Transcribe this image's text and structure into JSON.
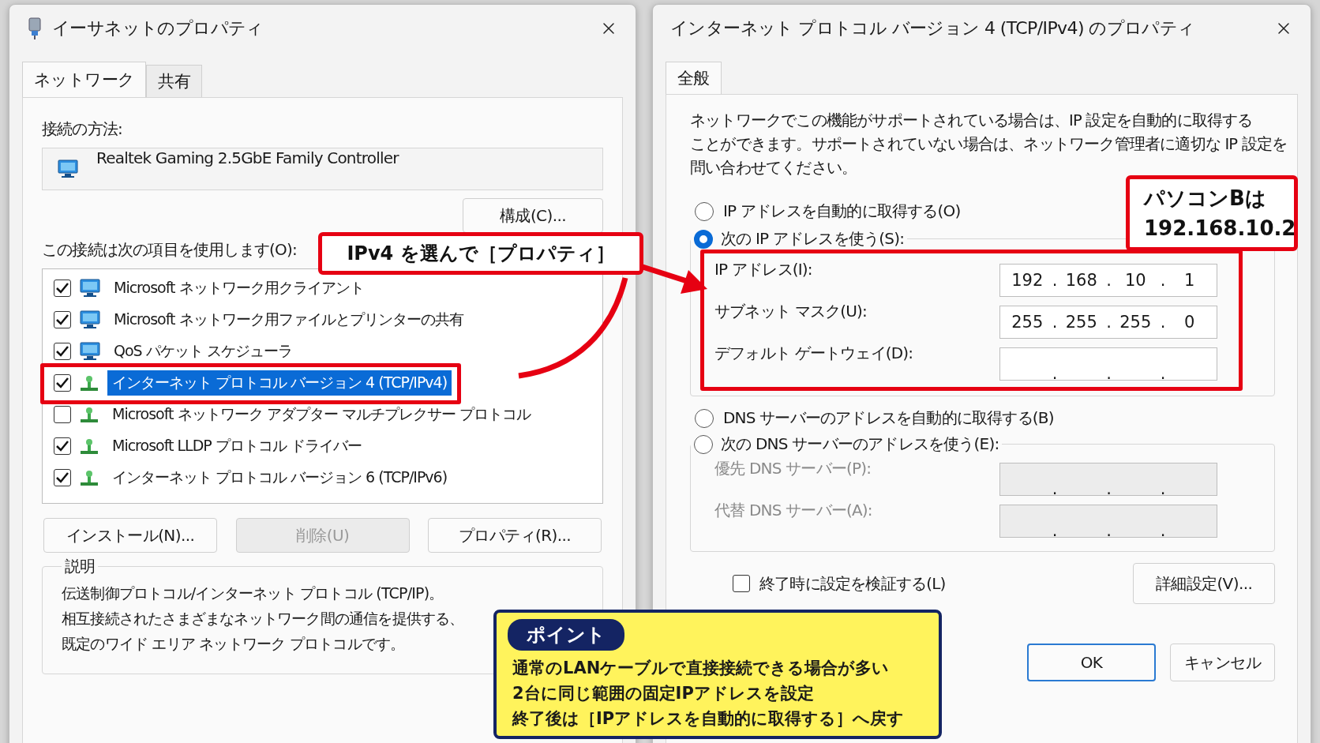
{
  "left_window": {
    "title": "イーサネットのプロパティ",
    "tabs": [
      {
        "label": "ネットワーク",
        "selected": true
      },
      {
        "label": "共有",
        "selected": false
      }
    ],
    "connect_using_label": "接続の方法:",
    "adapter": "Realtek Gaming 2.5GbE Family Controller",
    "configure_button": "構成(C)...",
    "items_label": "この接続は次の項目を使用します(O):",
    "items": [
      {
        "kind": "service",
        "label": "Microsoft ネットワーク用クライアント",
        "checked": true,
        "selected": false
      },
      {
        "kind": "service",
        "label": "Microsoft ネットワーク用ファイルとプリンターの共有",
        "checked": true,
        "selected": false
      },
      {
        "kind": "service",
        "label": "QoS パケット スケジューラ",
        "checked": true,
        "selected": false
      },
      {
        "kind": "protocol",
        "label": "インターネット プロトコル バージョン 4 (TCP/IPv4)",
        "checked": true,
        "selected": true
      },
      {
        "kind": "protocol",
        "label": "Microsoft ネットワーク アダプター マルチプレクサー プロトコル",
        "checked": false,
        "selected": false
      },
      {
        "kind": "protocol",
        "label": "Microsoft LLDP プロトコル ドライバー",
        "checked": true,
        "selected": false
      },
      {
        "kind": "protocol",
        "label": "インターネット プロトコル バージョン 6 (TCP/IPv6)",
        "checked": true,
        "selected": false
      }
    ],
    "buttons": [
      {
        "label": "インストール(N)...",
        "disabled": false
      },
      {
        "label": "削除(U)",
        "disabled": true
      },
      {
        "label": "プロパティ(R)...",
        "disabled": false
      }
    ],
    "description_label": "説明",
    "description_lines": [
      "伝送制御プロトコル/インターネット プロトコル (TCP/IP)。",
      "相互接続されたさまざまなネットワーク間の通信を提供する、",
      "既定のワイド エリア ネットワーク プロトコルです。"
    ]
  },
  "right_window": {
    "title": "インターネット プロトコル バージョン 4 (TCP/IPv4) のプロパティ",
    "tabs": [
      {
        "label": "全般",
        "selected": true
      }
    ],
    "intro_lines": [
      "ネットワークでこの機能がサポートされている場合は、IP 設定を自動的に取得する",
      "ことができます。サポートされていない場合は、ネットワーク管理者に適切な IP 設定を",
      "問い合わせてください。"
    ],
    "ip_auto": {
      "label": "IP アドレスを自動的に取得する(O)",
      "selected": false
    },
    "ip_manual": {
      "label": "次の IP アドレスを使う(S):",
      "selected": true
    },
    "ip_fields": [
      {
        "label": "IP アドレス(I):",
        "octets": [
          "192",
          "168",
          "10",
          "1"
        ],
        "separator": ".",
        "disabled": false
      },
      {
        "label": "サブネット マスク(U):",
        "octets": [
          "255",
          "255",
          "255",
          "0"
        ],
        "separator": ".",
        "disabled": false
      },
      {
        "label": "デフォルト ゲートウェイ(D):",
        "separator": ".",
        "disabled": false
      }
    ],
    "dns_auto": {
      "label": "DNS サーバーのアドレスを自動的に取得する(B)",
      "selected": false
    },
    "dns_manual": {
      "label": "次の DNS サーバーのアドレスを使う(E):",
      "selected": false
    },
    "dns_fields": [
      {
        "label": "優先 DNS サーバー(P):",
        "separator": ".",
        "disabled": true
      },
      {
        "label": "代替 DNS サーバー(A):",
        "separator": ".",
        "disabled": true
      }
    ],
    "validate": {
      "label": "終了時に設定を検証する(L)",
      "checked": false
    },
    "advanced_button": "詳細設定(V)...",
    "footer_buttons": [
      {
        "label": "OK",
        "default": true
      },
      {
        "label": "キャンセル",
        "default": false
      }
    ]
  },
  "annotations": {
    "ipv4_callout": "IPv4 を選んで［プロパティ］",
    "address_callout": [
      "パソコンBは",
      "192.168.10.2"
    ],
    "point": {
      "badge": "ポイント",
      "lines": [
        "通常のLANケーブルで直接接続できる場合が多い",
        "2台に同じ範囲の固定IPアドレスを設定",
        "終了後は［IPアドレスを自動的に取得する］へ戻す"
      ]
    }
  }
}
